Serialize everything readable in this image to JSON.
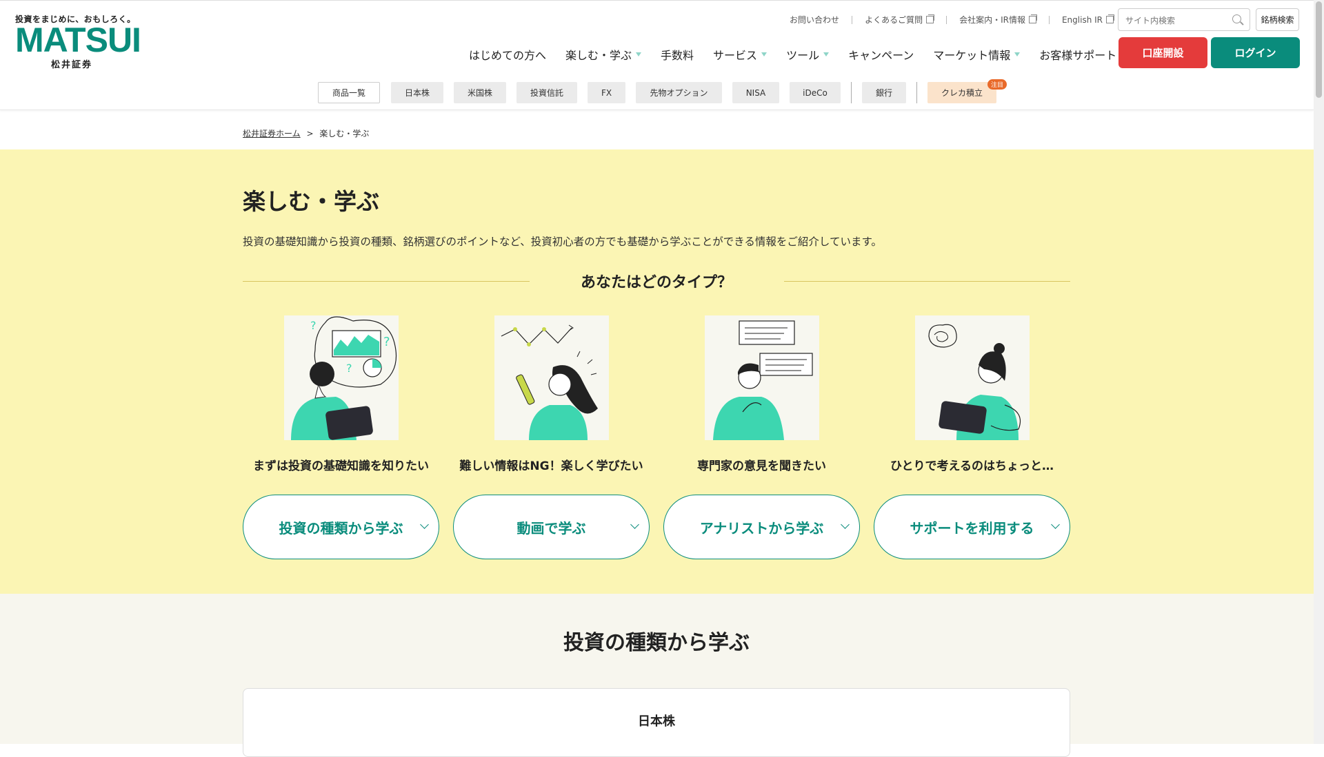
{
  "logo": {
    "tagline": "投資をまじめに、おもしろく。",
    "name": "MATSUI",
    "sub": "松井証券"
  },
  "util_nav": [
    "お問い合わせ",
    "よくあるご質問",
    "会社案内・IR情報",
    "English IR"
  ],
  "search": {
    "placeholder": "サイト内検索",
    "button": "銘柄検索"
  },
  "main_nav": [
    {
      "label": "はじめての方へ",
      "caret": false
    },
    {
      "label": "楽しむ・学ぶ",
      "caret": true
    },
    {
      "label": "手数料",
      "caret": false
    },
    {
      "label": "サービス",
      "caret": true
    },
    {
      "label": "ツール",
      "caret": true
    },
    {
      "label": "キャンペーン",
      "caret": false
    },
    {
      "label": "マーケット情報",
      "caret": true
    },
    {
      "label": "お客様サポート",
      "caret": true
    }
  ],
  "buttons": {
    "open_account": "口座開設",
    "login": "ログイン"
  },
  "sub_nav": [
    "商品一覧",
    "日本株",
    "米国株",
    "投資信託",
    "FX",
    "先物オプション",
    "NISA",
    "iDeCo",
    "銀行",
    "クレカ積立"
  ],
  "sub_nav_badge": "注目",
  "breadcrumb": {
    "home": "松井証券ホーム",
    "separator": ">",
    "current": "楽しむ・学ぶ"
  },
  "hero": {
    "title": "楽しむ・学ぶ",
    "description": "投資の基礎知識から投資の種類、銘柄選びのポイントなど、投資初心者の方でも基礎から学ぶことができる情報をご紹介しています。",
    "type_heading": "あなたはどのタイプ？"
  },
  "types": [
    {
      "caption": "まずは投資の基礎知識を知りたい",
      "button": "投資の種類から学ぶ"
    },
    {
      "caption": "難しい情報はNG！楽しく学びたい",
      "button": "動画で学ぶ"
    },
    {
      "caption": "専門家の意見を聞きたい",
      "button": "アナリストから学ぶ"
    },
    {
      "caption": "ひとりで考えるのはちょっと…",
      "button": "サポートを利用する"
    }
  ],
  "section2": {
    "title": "投資の種類から学ぶ",
    "card_title": "日本株"
  },
  "colors": {
    "brand_green": "#0a8c7c",
    "accent_red": "#e43b3b",
    "hero_bg": "#fbf5b4",
    "illustration_teal": "#3dd6b0"
  }
}
